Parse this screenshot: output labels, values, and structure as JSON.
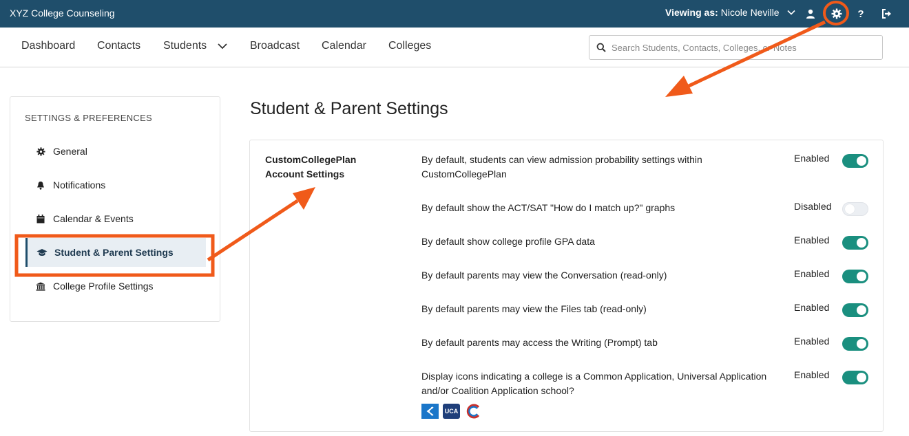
{
  "header": {
    "brand": "XYZ College Counseling",
    "viewing_label": "Viewing as:",
    "viewing_name": "Nicole Neville",
    "icons": [
      "chevron-down-icon",
      "user-icon",
      "gear-icon",
      "help-icon",
      "logout-icon"
    ],
    "help_glyph": "?"
  },
  "nav": {
    "items": [
      "Dashboard",
      "Contacts",
      "Students",
      "Broadcast",
      "Calendar",
      "Colleges"
    ],
    "search_placeholder": "Search Students, Contacts, Colleges, or Notes"
  },
  "sidebar": {
    "heading": "SETTINGS & PREFERENCES",
    "items": [
      {
        "label": "General",
        "icon": "gear-icon"
      },
      {
        "label": "Notifications",
        "icon": "bell-icon"
      },
      {
        "label": "Calendar & Events",
        "icon": "calendar-icon"
      },
      {
        "label": "Student & Parent Settings",
        "icon": "graduation-cap-icon",
        "active": true
      },
      {
        "label": "College Profile Settings",
        "icon": "institution-icon"
      }
    ]
  },
  "main": {
    "title": "Student & Parent Settings",
    "section_label": "CustomCollegePlan Account Settings",
    "settings": [
      {
        "text": "By default, students can view admission probability settings within CustomCollegePlan",
        "status": "Enabled",
        "on": true
      },
      {
        "text": "By default show the ACT/SAT \"How do I match up?\" graphs",
        "status": "Disabled",
        "on": false
      },
      {
        "text": "By default show college profile GPA data",
        "status": "Enabled",
        "on": true
      },
      {
        "text": "By default parents may view the Conversation (read-only)",
        "status": "Enabled",
        "on": true
      },
      {
        "text": "By default parents may view the Files tab (read-only)",
        "status": "Enabled",
        "on": true
      },
      {
        "text": "By default parents may access the Writing (Prompt) tab",
        "status": "Enabled",
        "on": true
      },
      {
        "text": "Display icons indicating a college is a Common Application, Universal Application and/or Coalition Application school?",
        "status": "Enabled",
        "on": true
      }
    ],
    "app_icons": [
      {
        "name": "common-app-icon",
        "text": ""
      },
      {
        "name": "universal-app-icon",
        "text": "UCA"
      },
      {
        "name": "coalition-app-icon",
        "text": ""
      }
    ]
  },
  "colors": {
    "header_bg": "#1f4e6b",
    "toggle_on": "#1a8f7f",
    "annotation": "#f05a1a"
  }
}
